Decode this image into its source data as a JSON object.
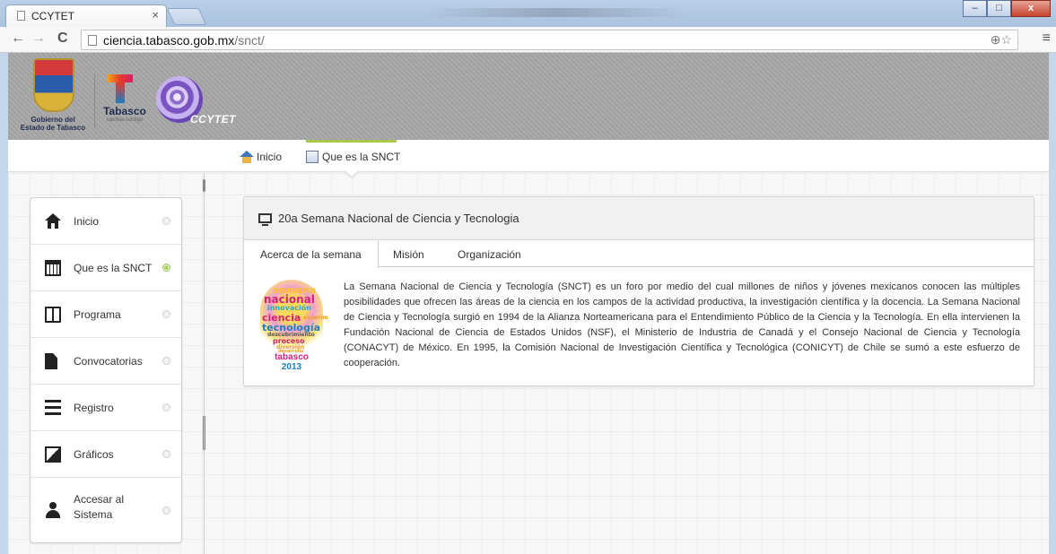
{
  "browser": {
    "tab_title": "CCYTET",
    "tab_close": "×",
    "url_host": "ciencia.tabasco.gob.mx",
    "url_path": "/snct/",
    "back": "←",
    "forward": "→",
    "reload": "C",
    "omni_icons": "⊕☆",
    "menu": "≡",
    "win_min": "–",
    "win_max": "□",
    "win_close": "x"
  },
  "header": {
    "gov_line1": "Gobierno del",
    "gov_line2": "Estado de Tabasco",
    "tabasco": "Tabasco",
    "tabasco_sub": "cambia contigo",
    "ccytet": "CCYTET"
  },
  "topnav": {
    "items": [
      {
        "label": "Inicio",
        "icon": "home-icon"
      },
      {
        "label": "Que es la SNCT",
        "icon": "document-icon"
      }
    ]
  },
  "sidebar": {
    "items": [
      {
        "label": "Inicio",
        "icon": "home-icon",
        "active": false
      },
      {
        "label": "Que es la SNCT",
        "icon": "calendar-icon",
        "active": true
      },
      {
        "label": "Programa",
        "icon": "book-icon",
        "active": false
      },
      {
        "label": "Convocatorias",
        "icon": "file-icon",
        "active": false
      },
      {
        "label": "Registro",
        "icon": "list-icon",
        "active": false
      },
      {
        "label": "Gráficos",
        "icon": "picture-icon",
        "active": false
      },
      {
        "label": "Accesar al Sistema",
        "icon": "user-icon",
        "active": false
      }
    ]
  },
  "panel": {
    "title": "20a Semana Nacional de Ciencia y Tecnologia",
    "tabs": [
      "Acerca de la semana",
      "Misión",
      "Organización"
    ],
    "logo_words": [
      "semana",
      "nacional",
      "innovación",
      "ciencia",
      "experim",
      "tecnología",
      "descubrimiento",
      "proceso",
      "diversión",
      "desarrollo"
    ],
    "logo_place": "tabasco",
    "logo_year": "2013",
    "text": "La Semana Nacional de Ciencia y Tecnología (SNCT) es un foro por medio del cual millones de niños y jóvenes mexicanos conocen las múltiples posibilidades que ofrecen las áreas de la ciencia en los campos de la actividad productiva, la investigación científica y la docencia. La Semana Nacional de Ciencia y Tecnología surgió en 1994 de la Alianza Norteamericana para el Entendimiento Público de la Ciencia y la Tecnología. En ella intervienen la Fundación Nacional de Ciencia de Estados Unidos (NSF), el Ministerio de Industria de Canadá y el Consejo Nacional de Ciencia y Tecnología (CONACYT) de México. En 1995, la Comisión Nacional de Investigación Científica y  Tecnológica (CONICYT) de Chile se sumó a este esfuerzo de cooperación."
  },
  "colors": {
    "accent": "#a5c84e",
    "active_dot": "#9cc85a"
  }
}
